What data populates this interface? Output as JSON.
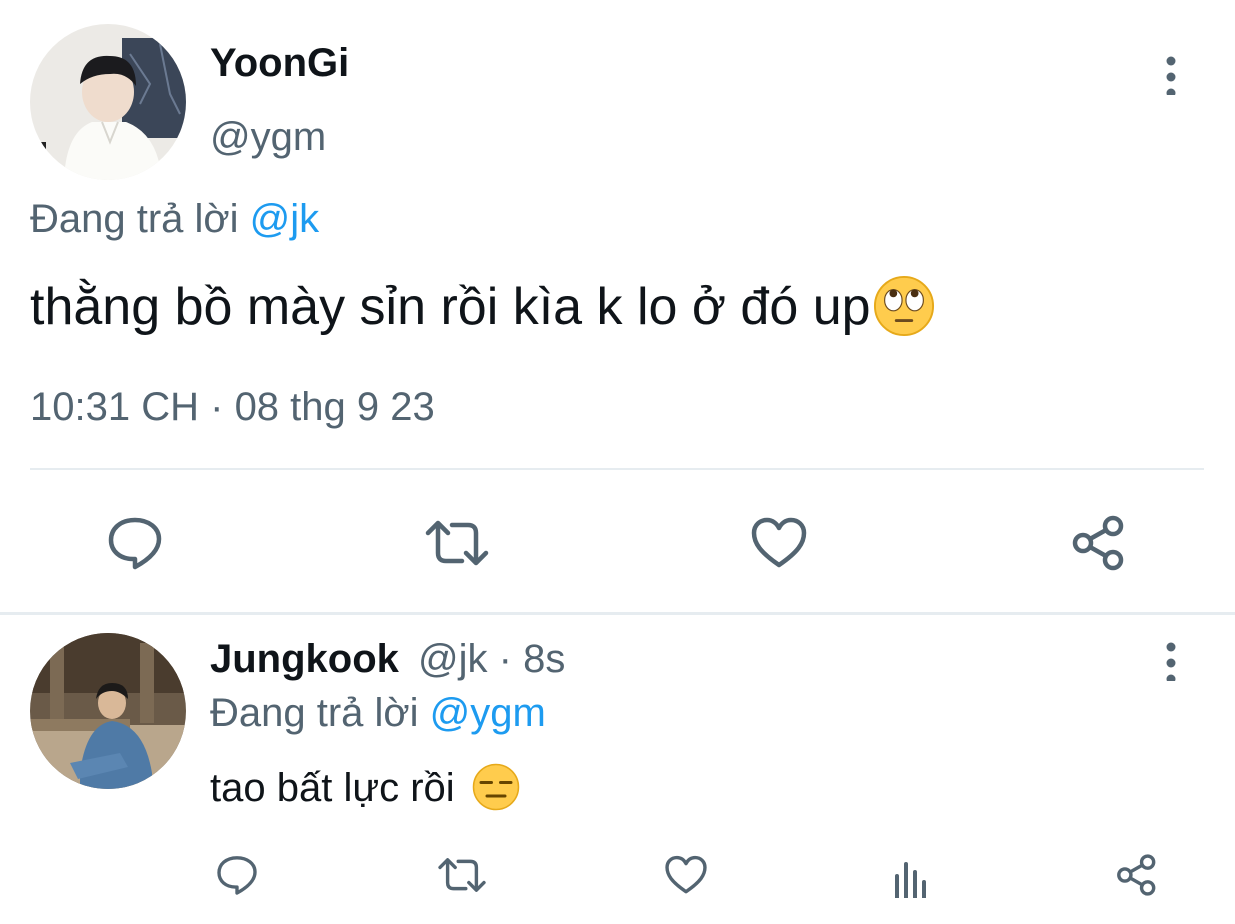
{
  "main_tweet": {
    "display_name": "YoonGi",
    "handle": "@ygm",
    "replying_prefix": "Đang trả lời",
    "replying_to": "@jk",
    "text": "thằng bồ mày sỉn rồi kìa k lo ở đó up",
    "text_emoji": "face-with-rolling-eyes",
    "time": "10:31 CH",
    "separator": "·",
    "date": "08 thg 9 23",
    "actions": [
      "reply-icon",
      "retweet-icon",
      "like-icon",
      "share-icon"
    ]
  },
  "reply_tweet": {
    "display_name": "Jungkook",
    "handle": "@jk",
    "separator": "·",
    "age": "8s",
    "replying_prefix": "Đang trả lời",
    "replying_to": "@ygm",
    "text": "tao bất lực rồi",
    "text_emoji": "expressionless-face",
    "actions": [
      "reply-icon",
      "retweet-icon",
      "like-icon",
      "analytics-icon",
      "share-icon"
    ]
  },
  "colors": {
    "text": "#0f1419",
    "muted": "#536471",
    "link": "#1d9bf0",
    "divider": "#e6ecf0"
  }
}
